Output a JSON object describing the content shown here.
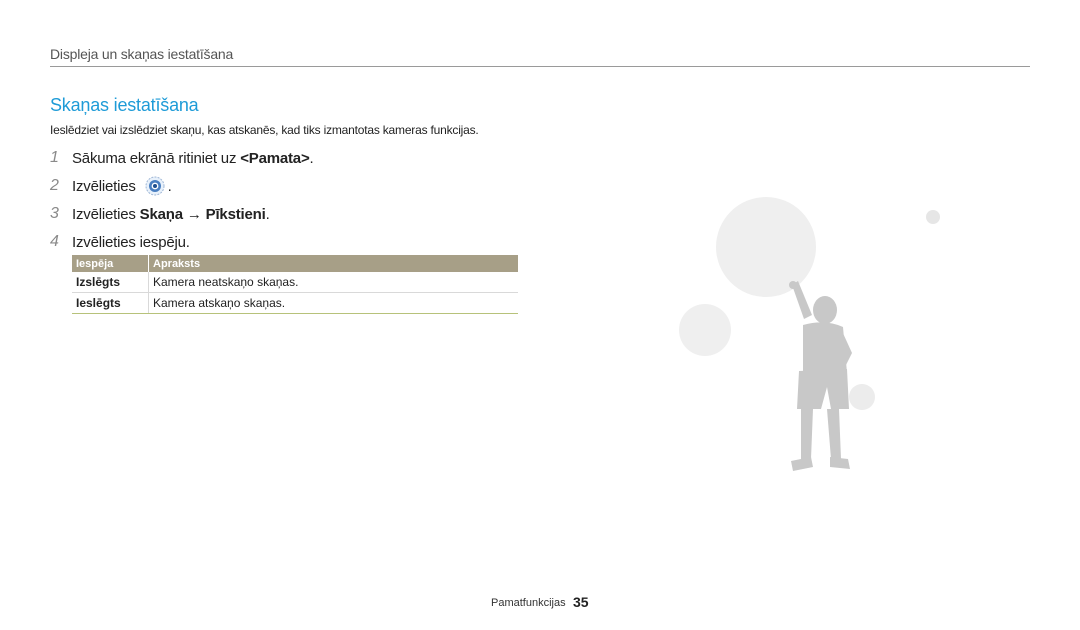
{
  "header": {
    "title": "Displeja un skaņas iestatīšana"
  },
  "section": {
    "title": "Skaņas iestatīšana",
    "intro": "Ieslēdziet vai izslēdziet skaņu, kas atskanēs, kad tiks izmantotas kameras funkcijas."
  },
  "steps": [
    {
      "num": "1",
      "text_before": "Sākuma ekrānā ritiniet uz ",
      "bold": "<Pamata>",
      "text_after": "."
    },
    {
      "num": "2",
      "text_before": "Izvēlieties ",
      "icon": "settings-gear-icon",
      "text_after": "."
    },
    {
      "num": "3",
      "text_before": "Izvēlieties ",
      "bold1": "Skaņa",
      "arrow": "→",
      "bold2": "Pīkstieni",
      "text_after": "."
    },
    {
      "num": "4",
      "text_before": "Izvēlieties iespēju."
    }
  ],
  "table": {
    "headers": [
      "Iespēja",
      "Apraksts"
    ],
    "rows": [
      {
        "name": "Izslēgts",
        "desc": "Kamera neatskaņo skaņas."
      },
      {
        "name": "Ieslēgts",
        "desc": "Kamera atskaņo skaņas."
      }
    ]
  },
  "footer": {
    "label": "Pamatfunkcijas",
    "page": "35"
  },
  "colors": {
    "accent": "#1e9bd7",
    "table_header": "#a79f87",
    "bubble": "#efefef",
    "figure": "#c8c8c8"
  },
  "illustration": {
    "icon": "child-pointing-bubbles-illustration"
  }
}
